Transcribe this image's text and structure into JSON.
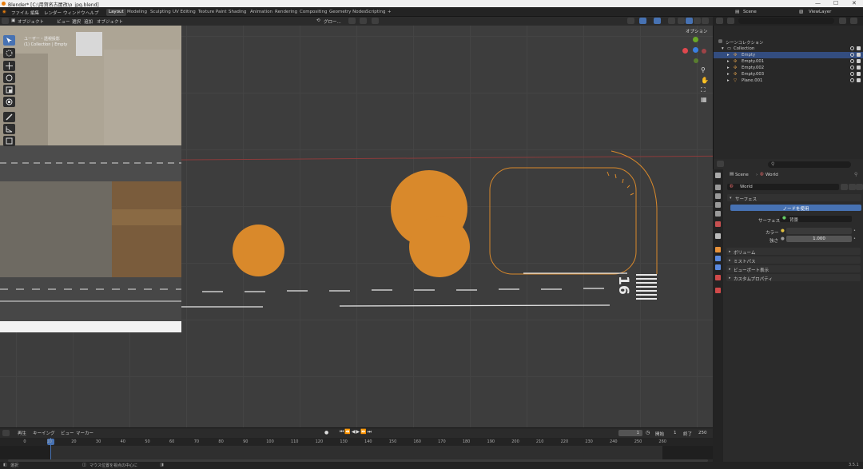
{
  "window": {
    "title": "Blender* [C:\\用賀名古屋改\\o_jpg.blend]",
    "minimize": "—",
    "maximize": "☐",
    "close": "✕"
  },
  "menu": {
    "items": [
      "ファイル",
      "編集",
      "レンダー",
      "ウィンドウ",
      "ヘルプ"
    ],
    "workspaces": [
      "Layout",
      "Modeling",
      "Sculpting",
      "UV Editing",
      "Texture Paint",
      "Shading",
      "Animation",
      "Rendering",
      "Compositing",
      "Geometry Nodes",
      "Scripting"
    ],
    "active_workspace": "Layout",
    "add_tab": "+",
    "scene": "Scene",
    "view_layer": "ViewLayer"
  },
  "viewport": {
    "mode": "オブジェクト",
    "menus": [
      "ビュー",
      "選択",
      "追加",
      "オブジェクト"
    ],
    "transform_orientation": "グロー...",
    "options": "オプション",
    "overlay_title": "ユーザー・透視投影",
    "overlay_subtitle": "(1) Collection | Empty",
    "runway_number": "16"
  },
  "outliner": {
    "root": "シーンコレクション",
    "collection": "Collection",
    "items": [
      {
        "label": "Empty",
        "selected": true
      },
      {
        "label": "Empty.001",
        "selected": false
      },
      {
        "label": "Empty.002",
        "selected": false
      },
      {
        "label": "Empty.003",
        "selected": false
      },
      {
        "label": "Plane.001",
        "selected": false
      }
    ]
  },
  "properties": {
    "breadcrumb_scene": "Scene",
    "breadcrumb_world": "World",
    "world_name": "World",
    "surface_section": "サーフェス",
    "use_nodes": "ノードを使用",
    "surface_label": "サーフェス",
    "surface_value": "背景",
    "color_label": "カラー",
    "strength_label": "強さ",
    "strength_value": "1.000",
    "sections": [
      "ボリューム",
      "ミストパス",
      "ビューポート表示",
      "カスタムプロパティ"
    ]
  },
  "timeline": {
    "menus": [
      "再生",
      "キーイング",
      "ビュー",
      "マーカー"
    ],
    "current_frame": "1",
    "start_label": "開始",
    "start_value": "1",
    "end_label": "終了",
    "end_value": "250",
    "ticks": [
      "0",
      "10",
      "20",
      "30",
      "40",
      "50",
      "60",
      "70",
      "80",
      "90",
      "100",
      "110",
      "120",
      "130",
      "140",
      "150",
      "160",
      "170",
      "180",
      "190",
      "200",
      "210",
      "220",
      "230",
      "240",
      "250",
      "260"
    ]
  },
  "status": {
    "left": "選択",
    "mid": "マウス位置を視点の中心に",
    "version": "3.5.1"
  },
  "colors": {
    "accent": "#4772b3",
    "overlay_orange": "#d9892b",
    "axis_x": "#e0484e",
    "axis_y": "#6aa827",
    "axis_z": "#3a7fe0"
  }
}
